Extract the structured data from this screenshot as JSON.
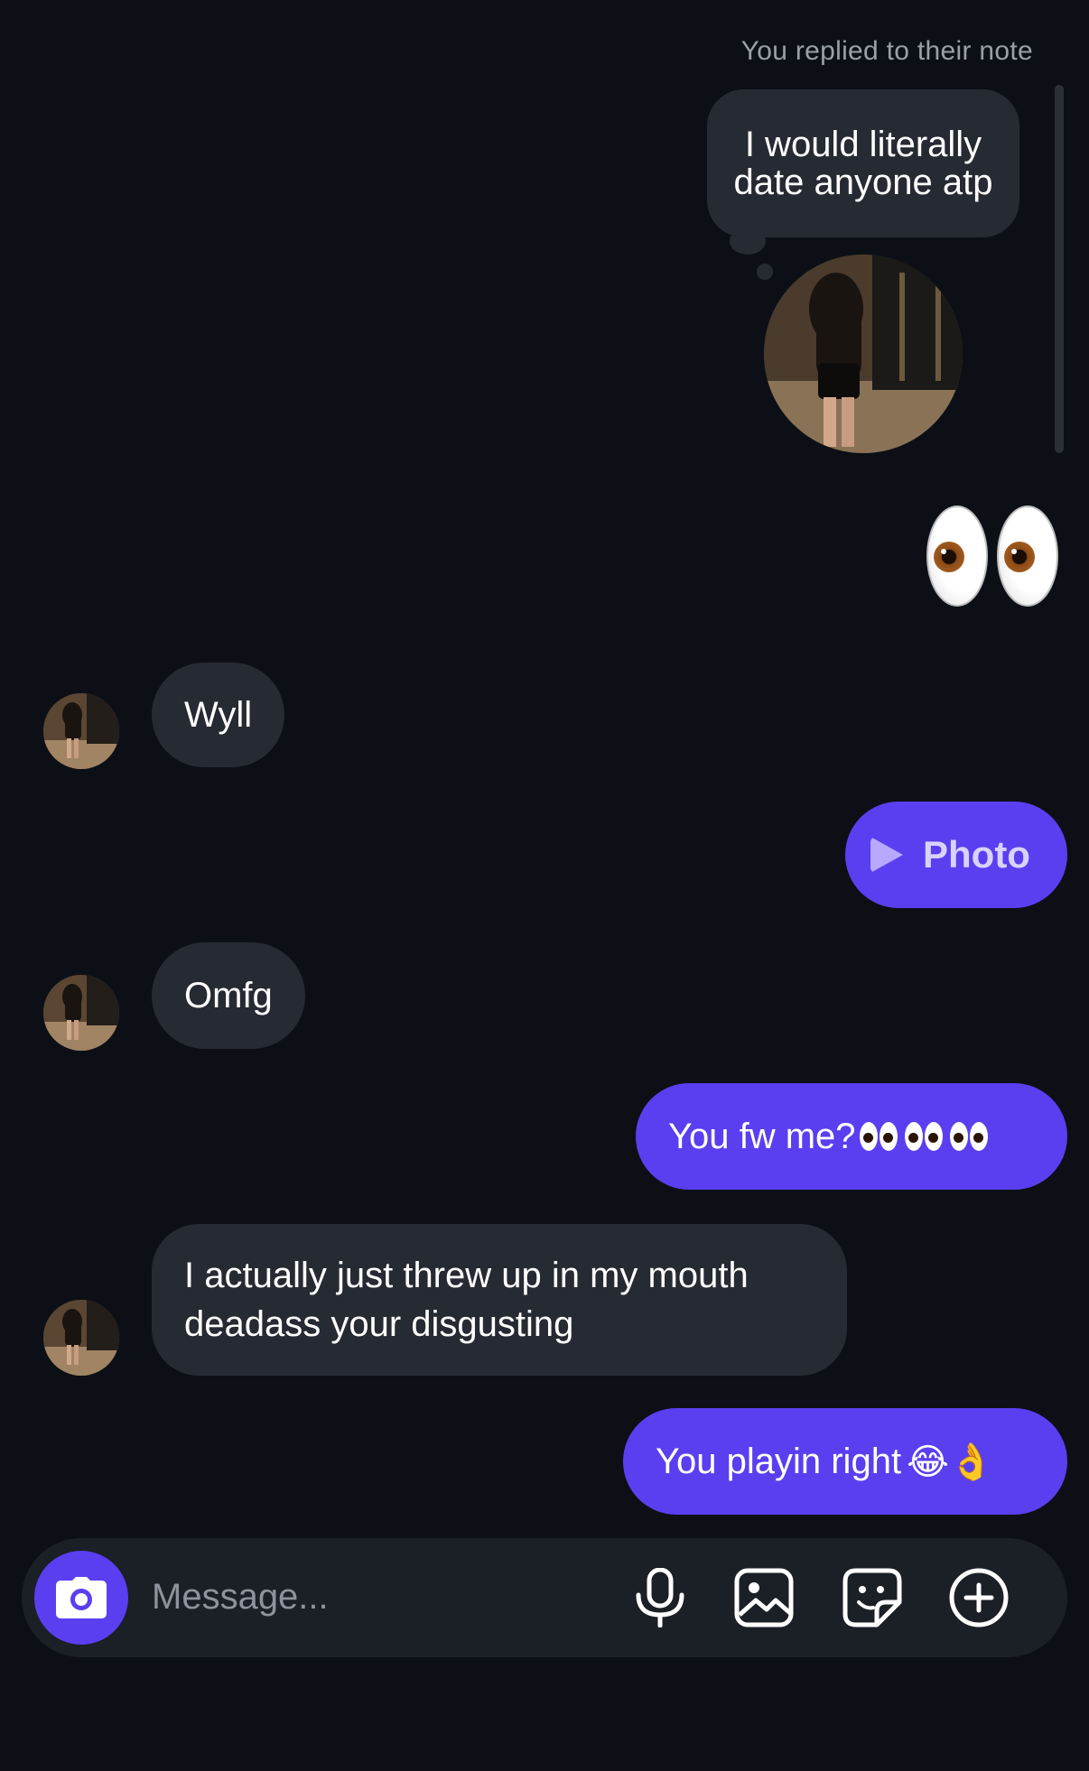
{
  "header": {
    "reply_caption": "You replied to their note"
  },
  "note": {
    "text": "I would literally date anyone atp"
  },
  "messages": [
    {
      "side": "out",
      "type": "emoji",
      "content": "👀"
    },
    {
      "side": "in",
      "text": "Wyll"
    },
    {
      "side": "out",
      "type": "attachment",
      "text": "Photo"
    },
    {
      "side": "in",
      "text": "Omfg"
    },
    {
      "side": "out",
      "text": "You fw me?",
      "trailing_emoji": "👀👀👀"
    },
    {
      "side": "in",
      "text": "I actually just threw up in my mouth deadass your disgusting"
    },
    {
      "side": "out",
      "text": "You playin right",
      "trailing_emoji": "😂👌"
    }
  ],
  "composer": {
    "placeholder": "Message...",
    "icons": [
      "camera-icon",
      "microphone-icon",
      "gallery-icon",
      "sticker-icon",
      "plus-icon"
    ]
  },
  "colors": {
    "background": "#0c1016",
    "incoming_bubble": "#262a32",
    "outgoing_bubble": "#5a3ff0",
    "caption": "#9aa0a8"
  }
}
